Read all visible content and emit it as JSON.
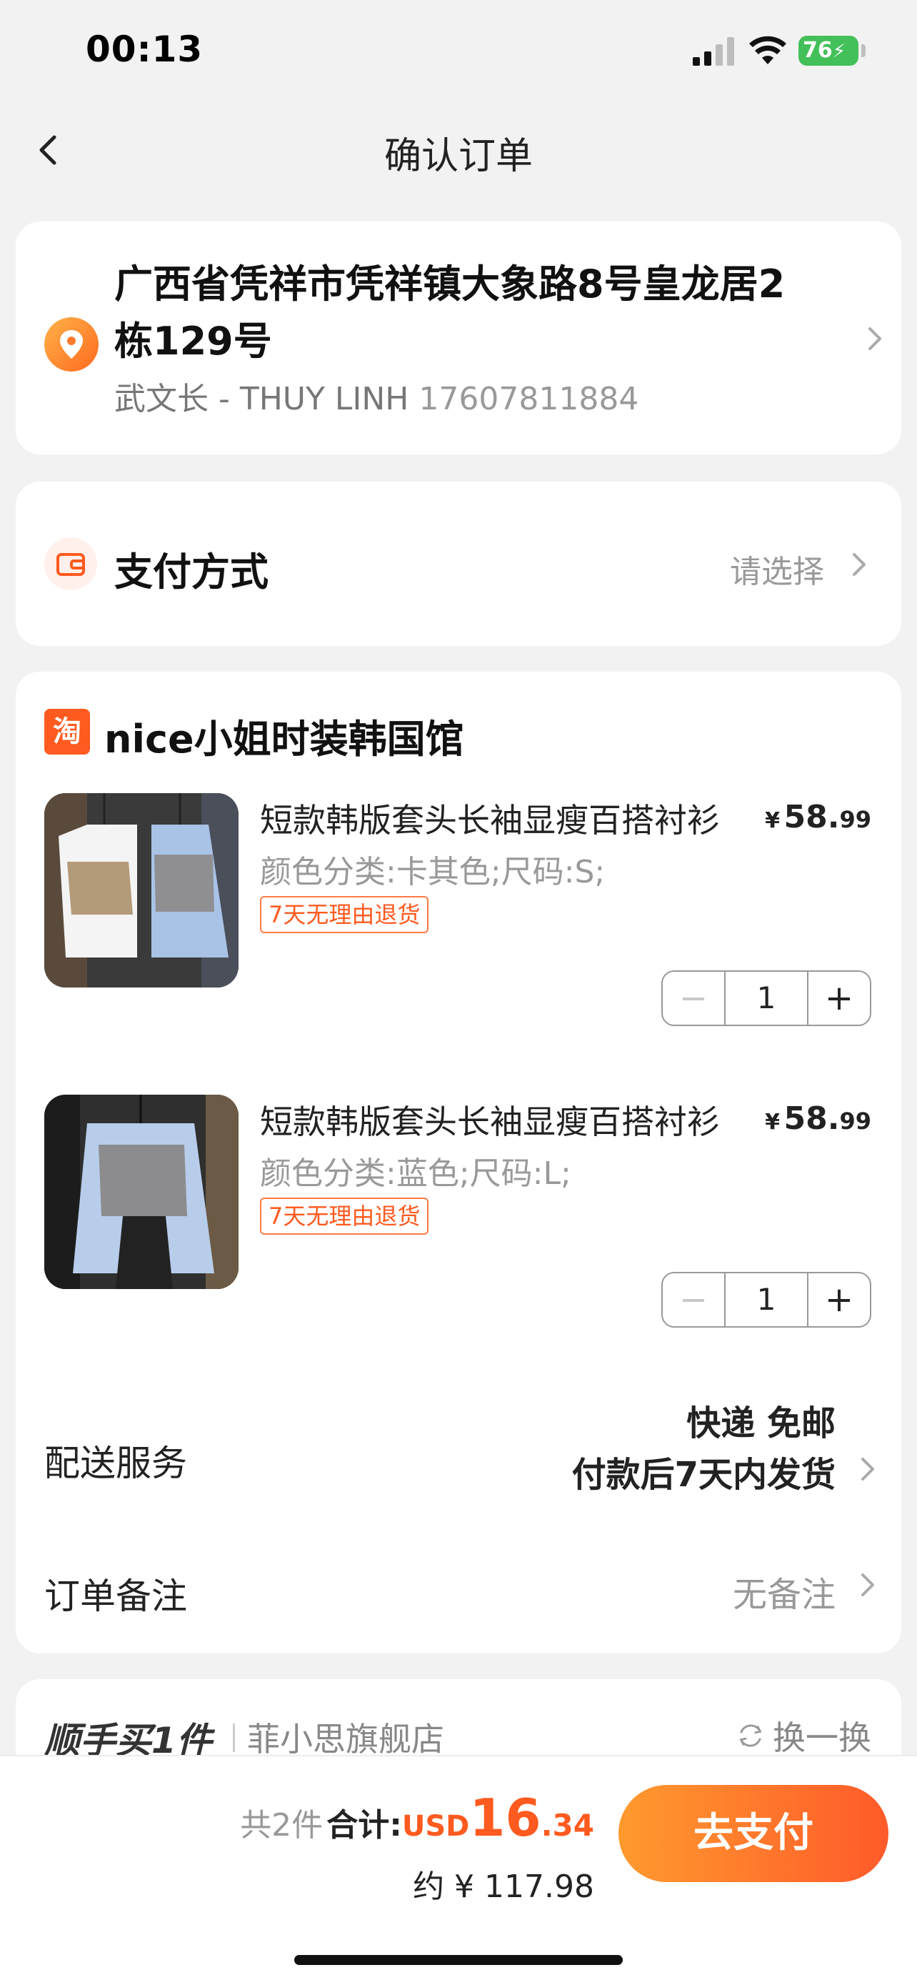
{
  "status_bar": {
    "time": "00:13",
    "battery": "76"
  },
  "nav": {
    "title": "确认订单"
  },
  "address": {
    "line": "广西省凭祥市凭祥镇大象路8号皇龙居2栋129号",
    "recipient": "武文长 - THUY LINH",
    "phone": "17607811884"
  },
  "payment": {
    "label": "支付方式",
    "value": "请选择"
  },
  "shop": {
    "logo_text": "淘",
    "name": "nice小姐时装韩国馆",
    "items": [
      {
        "title": "短款韩版套头长袖显瘦百搭衬衫",
        "spec": "颜色分类:卡其色;尺码:S;",
        "badge": "7天无理由退货",
        "price_currency": "¥",
        "price_int": "58.",
        "price_dec": "99",
        "qty": "1"
      },
      {
        "title": "短款韩版套头长袖显瘦百搭衬衫",
        "spec": "颜色分类:蓝色;尺码:L;",
        "badge": "7天无理由退货",
        "price_currency": "¥",
        "price_int": "58.",
        "price_dec": "99",
        "qty": "1"
      }
    ],
    "shipping": {
      "label": "配送服务",
      "line1": "快递 免邮",
      "line2": "付款后7天内发货"
    },
    "note": {
      "label": "订单备注",
      "value": "无备注"
    }
  },
  "recommend": {
    "title": "顺手买1件",
    "store": "菲小思旗舰店",
    "refresh": "换一换"
  },
  "bottom": {
    "count": "共2件",
    "total_label": "合计:",
    "currency": "USD",
    "amount_int": "16",
    "amount_dec": ".34",
    "approx": "约 ¥ 117.98",
    "pay_button": "去支付"
  },
  "colors": {
    "accent": "#ff5a1f",
    "button_start": "#ff9a2e",
    "button_end": "#ff5a2a"
  }
}
